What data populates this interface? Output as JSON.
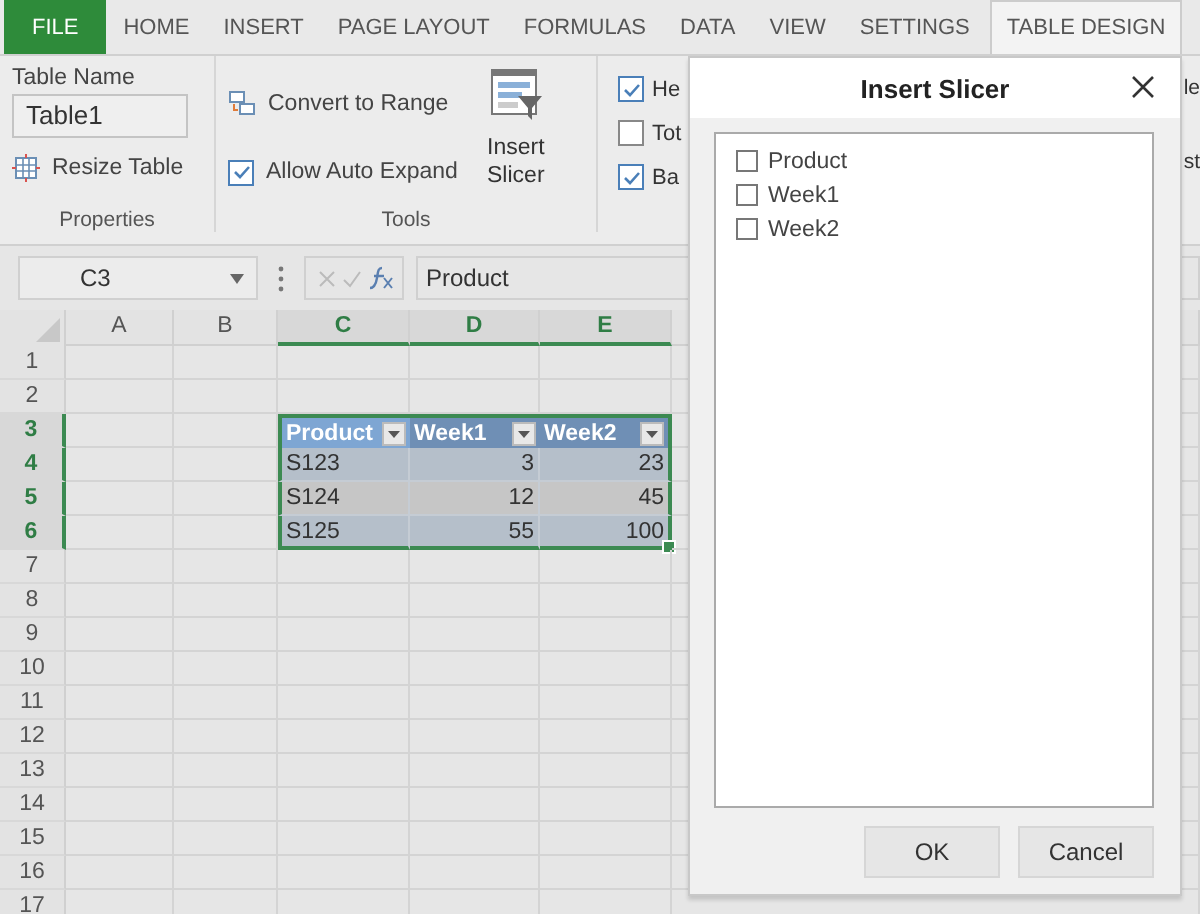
{
  "tabs": [
    {
      "label": "FILE",
      "kind": "file",
      "selected": false
    },
    {
      "label": "HOME",
      "kind": "tab",
      "selected": false
    },
    {
      "label": "INSERT",
      "kind": "tab",
      "selected": false
    },
    {
      "label": "PAGE LAYOUT",
      "kind": "tab",
      "selected": false
    },
    {
      "label": "FORMULAS",
      "kind": "tab",
      "selected": false
    },
    {
      "label": "DATA",
      "kind": "tab",
      "selected": false
    },
    {
      "label": "VIEW",
      "kind": "tab",
      "selected": false
    },
    {
      "label": "SETTINGS",
      "kind": "tab",
      "selected": false
    },
    {
      "label": "TABLE DESIGN",
      "kind": "tab",
      "selected": true
    }
  ],
  "ribbon": {
    "properties": {
      "table_name_label": "Table Name",
      "table_name": "Table1",
      "resize": "Resize Table",
      "group_label": "Properties"
    },
    "tools": {
      "convert": "Convert to Range",
      "auto_expand": {
        "label": "Allow Auto Expand",
        "checked": true
      },
      "insert_slicer": "Insert Slicer",
      "group_label": "Tools"
    },
    "style_options": [
      {
        "label": "He",
        "checked": true
      },
      {
        "label": "Tot",
        "checked": false
      },
      {
        "label": "Ba",
        "checked": true
      }
    ],
    "right_fragments": [
      "le",
      "st"
    ]
  },
  "formula_bar": {
    "name_box": "C3",
    "formula": "Product"
  },
  "sheet": {
    "columns": [
      {
        "label": "A",
        "selected": false
      },
      {
        "label": "B",
        "selected": false
      },
      {
        "label": "C",
        "selected": true
      },
      {
        "label": "D",
        "selected": true
      },
      {
        "label": "E",
        "selected": true
      }
    ],
    "rows": [
      {
        "label": "1",
        "selected": false
      },
      {
        "label": "2",
        "selected": false
      },
      {
        "label": "3",
        "selected": true
      },
      {
        "label": "4",
        "selected": true
      },
      {
        "label": "5",
        "selected": true
      },
      {
        "label": "6",
        "selected": true
      },
      {
        "label": "7",
        "selected": false
      },
      {
        "label": "8",
        "selected": false
      },
      {
        "label": "9",
        "selected": false
      },
      {
        "label": "10",
        "selected": false
      },
      {
        "label": "11",
        "selected": false
      },
      {
        "label": "12",
        "selected": false
      },
      {
        "label": "13",
        "selected": false
      },
      {
        "label": "14",
        "selected": false
      },
      {
        "label": "15",
        "selected": false
      },
      {
        "label": "16",
        "selected": false
      },
      {
        "label": "17",
        "selected": false
      }
    ],
    "table": {
      "headers": [
        "Product",
        "Week1",
        "Week2"
      ],
      "rows": [
        [
          "S123",
          "3",
          "23"
        ],
        [
          "S124",
          "12",
          "45"
        ],
        [
          "S125",
          "55",
          "100"
        ]
      ]
    }
  },
  "dialog": {
    "title": "Insert Slicer",
    "fields": [
      {
        "label": "Product",
        "checked": false
      },
      {
        "label": "Week1",
        "checked": false
      },
      {
        "label": "Week2",
        "checked": false
      }
    ],
    "buttons": [
      "OK",
      "Cancel"
    ]
  }
}
